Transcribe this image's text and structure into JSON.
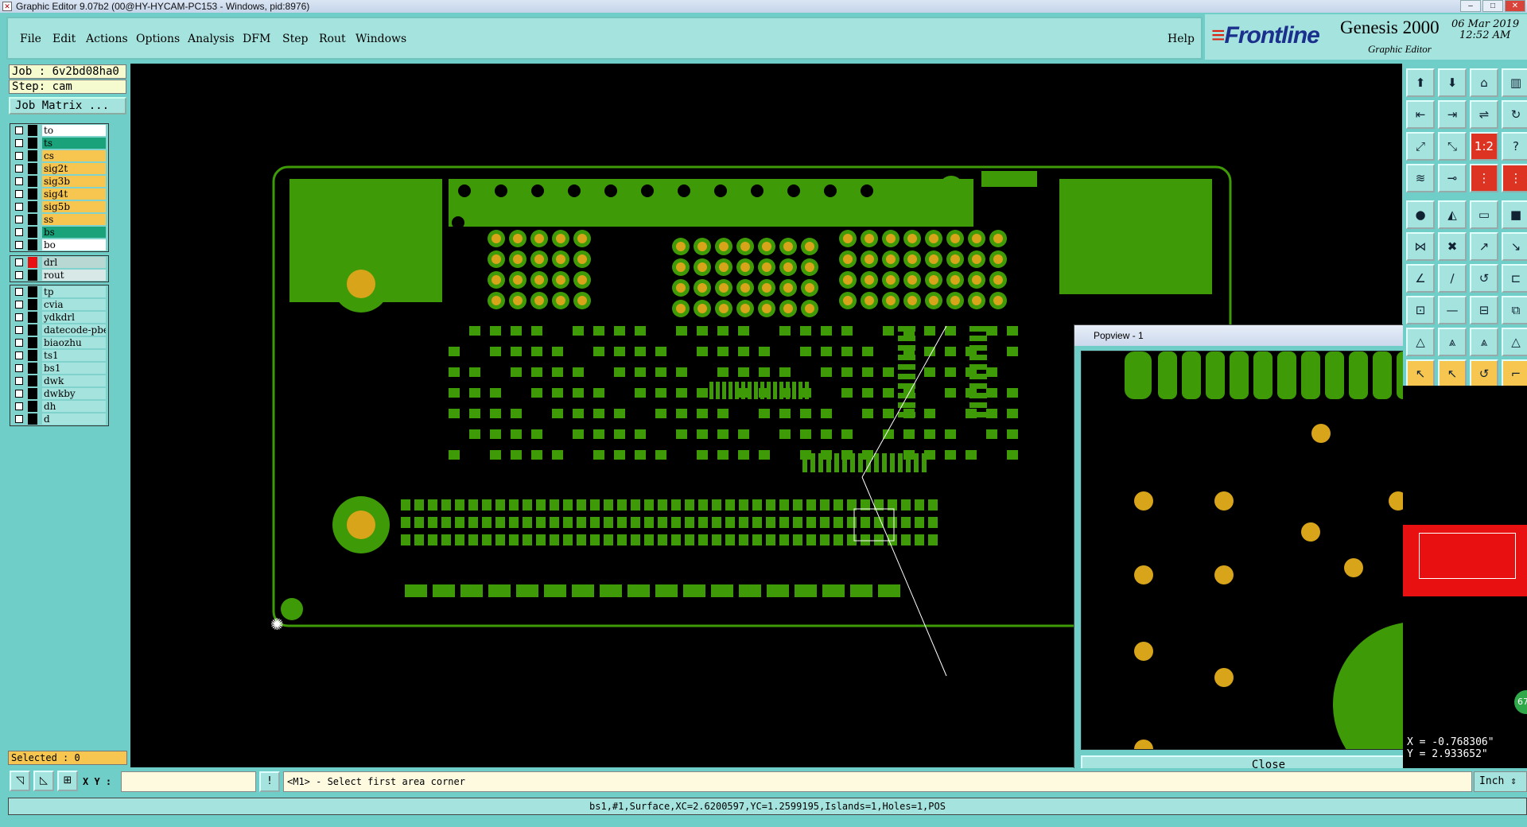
{
  "window": {
    "title": "Graphic Editor 9.07b2 (00@HY-HYCAM-PC153 - Windows, pid:8976)",
    "controls": [
      "–",
      "□",
      "✕"
    ]
  },
  "menu": {
    "items": [
      "File",
      "Edit",
      "Actions",
      "Options",
      "Analysis",
      "DFM",
      "Step",
      "Rout",
      "Windows"
    ],
    "help": "Help"
  },
  "brand": {
    "logo_prefix": "≡",
    "logo": "Frontline",
    "product": "Genesis 2000",
    "subtitle": "Graphic Editor",
    "date": "06 Mar 2019",
    "time": "12:52 AM"
  },
  "left": {
    "job": "Job : 6v2bd08ha0",
    "step": "Step: cam",
    "job_matrix": "Job Matrix ...",
    "layers_group1": [
      {
        "name": "to",
        "color": "#ffffff"
      },
      {
        "name": "ts",
        "color": "#1aa37a"
      },
      {
        "name": "cs",
        "color": "#f7c650"
      },
      {
        "name": "sig2t",
        "color": "#f7c650"
      },
      {
        "name": "sig3b",
        "color": "#f7c650"
      },
      {
        "name": "sig4t",
        "color": "#f7c650"
      },
      {
        "name": "sig5b",
        "color": "#f7c650"
      },
      {
        "name": "ss",
        "color": "#f7c650"
      },
      {
        "name": "bs",
        "color": "#1aa37a"
      },
      {
        "name": "bo",
        "color": "#ffffff"
      }
    ],
    "layers_group2": [
      {
        "name": "drl",
        "color": "#b8d8d4"
      },
      {
        "name": "rout",
        "color": "#d8e8e6"
      }
    ],
    "layers_group3": [
      {
        "name": "tp",
        "color": "#a5e4de"
      },
      {
        "name": "cvia",
        "color": "#a5e4de"
      },
      {
        "name": "ydkdrl",
        "color": "#a5e4de"
      },
      {
        "name": "datecode-pbe",
        "color": "#a5e4de"
      },
      {
        "name": "biaozhu",
        "color": "#a5e4de"
      },
      {
        "name": "ts1",
        "color": "#a5e4de"
      },
      {
        "name": "bs1",
        "color": "#a5e4de"
      },
      {
        "name": "dwk",
        "color": "#a5e4de"
      },
      {
        "name": "dwkby",
        "color": "#a5e4de"
      },
      {
        "name": "dh",
        "color": "#a5e4de"
      },
      {
        "name": "d",
        "color": "#a5e4de"
      }
    ],
    "selected": "Selected : 0"
  },
  "popview": {
    "title": "Popview - 1",
    "close_x": "✕",
    "close_button": "Close",
    "tools": [
      "⧉",
      "⬓",
      "⬒",
      "◧",
      "◨",
      "⤢",
      "⤡"
    ]
  },
  "toolbox": {
    "rows": [
      [
        "⬆",
        "⬇",
        "⌂",
        "▥"
      ],
      [
        "⇤",
        "⇥",
        "⇌",
        "↻"
      ],
      [
        "⤢",
        "⤡",
        "1:2",
        "?"
      ],
      [
        "≋",
        "⊸",
        "⋮",
        "⋮"
      ],
      [
        "●",
        "◭",
        "▭",
        "■"
      ],
      [
        "⋈",
        "✖",
        "↗",
        "↘"
      ],
      [
        "∠",
        "∕",
        "↺",
        "⊏"
      ],
      [
        "⊡",
        "—",
        "⊟",
        "⧉"
      ],
      [
        "△",
        "⩓",
        "⩓",
        "△"
      ],
      [
        "↖",
        "↖",
        "↺",
        "⌐"
      ]
    ]
  },
  "coords": {
    "x": "X = -0.768306\"",
    "y": "Y = 2.933652\"",
    "zoom": "67"
  },
  "status": {
    "xy_label": "X Y :",
    "xy_value": "",
    "warn": "!",
    "prompt": "<M1> - Select first area corner",
    "units": "Inch ⇕",
    "bottom": "bs1,#1,Surface,XC=2.6200597,YC=1.2599195,Islands=1,Holes=1,POS"
  },
  "colors": {
    "board": "#3e9a06",
    "pad": "#d8a41a",
    "canvas": "#000000",
    "panel": "#6fcfc8"
  }
}
